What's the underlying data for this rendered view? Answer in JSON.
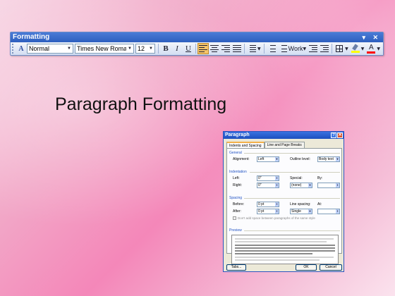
{
  "toolbar": {
    "title": "Formatting",
    "title_controls": "▾ ✕",
    "style_value": "Normal",
    "font_value": "Times New Roman",
    "size_value": "12",
    "bold": "B",
    "italic": "I",
    "underline": "U",
    "work_label": "Work",
    "highlight_color": "#ffff00",
    "font_color": "#ff0000"
  },
  "slide": {
    "heading": "Paragraph Formatting"
  },
  "dialog": {
    "title": "Paragraph",
    "help_btn": "?",
    "close_btn": "✕",
    "tabs": [
      "Indents and Spacing",
      "Line and Page Breaks"
    ],
    "general": {
      "section": "General",
      "alignment_label": "Alignment:",
      "alignment_value": "Left",
      "outline_label": "Outline level:",
      "outline_value": "Body text"
    },
    "indentation": {
      "section": "Indentation",
      "left_label": "Left:",
      "left_value": "0\"",
      "right_label": "Right:",
      "right_value": "0\"",
      "special_label": "Special:",
      "special_value": "(none)",
      "by_label": "By:"
    },
    "spacing": {
      "section": "Spacing",
      "before_label": "Before:",
      "before_value": "0 pt",
      "after_label": "After:",
      "after_value": "0 pt",
      "line_spacing_label": "Line spacing:",
      "line_spacing_value": "Single",
      "at_label": "At:",
      "dont_add_label": "Don't add space between paragraphs of the same style"
    },
    "preview": {
      "section": "Preview"
    },
    "buttons": {
      "tabs_button": "Tabs...",
      "ok": "OK",
      "cancel": "Cancel"
    }
  }
}
